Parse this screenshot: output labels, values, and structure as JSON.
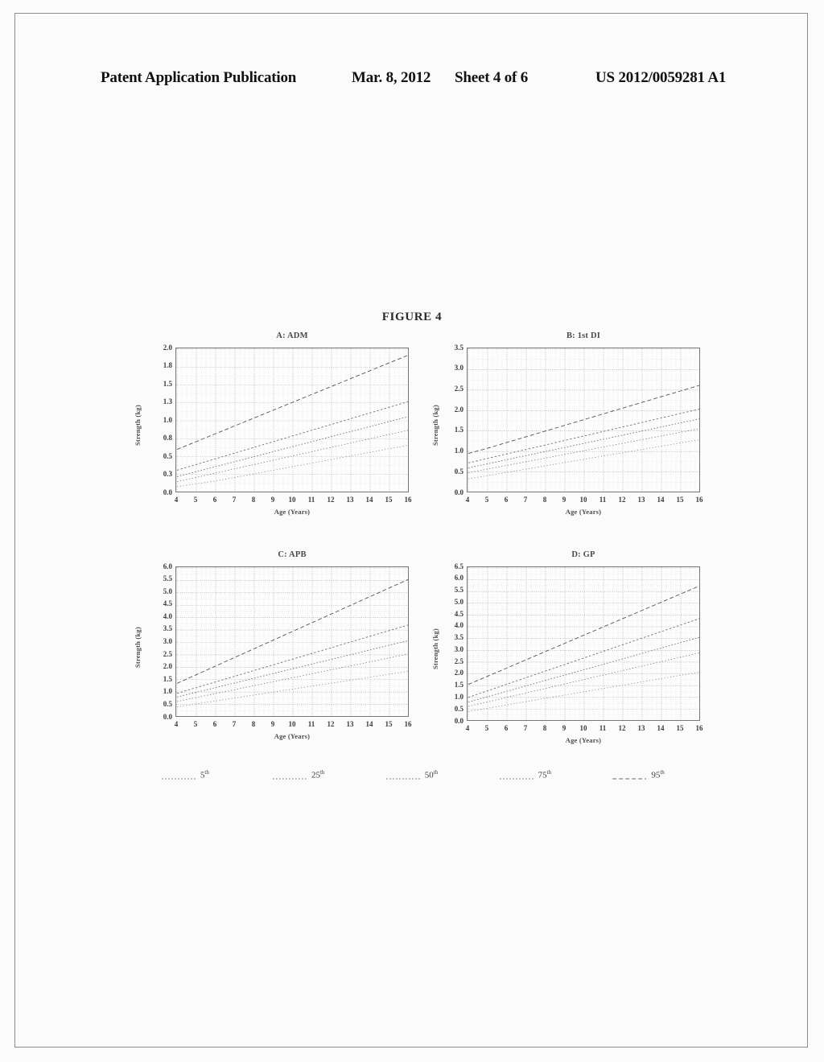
{
  "header": {
    "publication": "Patent Application Publication",
    "date": "Mar. 8, 2012",
    "sheet": "Sheet 4 of 6",
    "number": "US 2012/0059281 A1"
  },
  "figure": {
    "title": "FIGURE 4"
  },
  "legend": {
    "items": [
      {
        "label": "5",
        "suffix": "th",
        "style": "dotted"
      },
      {
        "label": "25",
        "suffix": "th",
        "style": "dotted"
      },
      {
        "label": "50",
        "suffix": "th",
        "style": "dotted"
      },
      {
        "label": "75",
        "suffix": "th",
        "style": "dotted"
      },
      {
        "label": "95",
        "suffix": "th",
        "style": "dashed"
      }
    ]
  },
  "chart_data": [
    {
      "id": "panel-a",
      "type": "line",
      "title": "A: ADM",
      "xlabel": "Age (Years)",
      "ylabel": "Strength (kg)",
      "x": [
        4,
        5,
        6,
        7,
        8,
        9,
        10,
        11,
        12,
        13,
        14,
        15,
        16
      ],
      "xticklabels": [
        "4",
        "5",
        "6",
        "7",
        "8",
        "9",
        "10",
        "11",
        "12",
        "13",
        "14",
        "15",
        "16"
      ],
      "xlim": [
        4,
        16
      ],
      "ylim": [
        0.0,
        2.0
      ],
      "yticks": [
        2.0,
        1.75,
        1.5,
        1.25,
        1.0,
        0.75,
        0.5,
        0.25,
        0.0
      ],
      "yticklabels": [
        "2.0",
        "1.8",
        "1.5",
        "1.3",
        "1.0",
        "0.8",
        "0.5",
        "0.3",
        "0.0"
      ],
      "grid": true,
      "legend_position": "below-figure",
      "series": [
        {
          "name": "95th",
          "values": [
            0.6,
            0.71,
            0.82,
            0.93,
            1.04,
            1.15,
            1.26,
            1.37,
            1.48,
            1.59,
            1.7,
            1.81,
            1.92
          ]
        },
        {
          "name": "75th",
          "values": [
            0.31,
            0.39,
            0.47,
            0.55,
            0.63,
            0.71,
            0.79,
            0.87,
            0.95,
            1.03,
            1.11,
            1.19,
            1.27
          ]
        },
        {
          "name": "50th",
          "values": [
            0.22,
            0.29,
            0.36,
            0.43,
            0.5,
            0.57,
            0.64,
            0.71,
            0.78,
            0.85,
            0.92,
            0.99,
            1.06
          ]
        },
        {
          "name": "25th",
          "values": [
            0.15,
            0.21,
            0.27,
            0.33,
            0.39,
            0.45,
            0.51,
            0.57,
            0.63,
            0.69,
            0.75,
            0.81,
            0.87
          ]
        },
        {
          "name": "5th",
          "values": [
            0.08,
            0.12,
            0.16,
            0.21,
            0.26,
            0.31,
            0.36,
            0.41,
            0.46,
            0.51,
            0.56,
            0.61,
            0.66
          ]
        }
      ]
    },
    {
      "id": "panel-b",
      "type": "line",
      "title": "B: 1st DI",
      "xlabel": "Age (Years)",
      "ylabel": "Strength (kg)",
      "x": [
        4,
        5,
        6,
        7,
        8,
        9,
        10,
        11,
        12,
        13,
        14,
        15,
        16
      ],
      "xticklabels": [
        "4",
        "5",
        "6",
        "7",
        "8",
        "9",
        "10",
        "11",
        "12",
        "13",
        "14",
        "15",
        "16"
      ],
      "xlim": [
        4,
        16
      ],
      "ylim": [
        0.0,
        3.5
      ],
      "yticks": [
        3.5,
        3.0,
        2.5,
        2.0,
        1.5,
        1.0,
        0.5,
        0.0
      ],
      "yticklabels": [
        "3.5",
        "3.0",
        "2.5",
        "2.0",
        "1.5",
        "1.0",
        "0.5",
        "0.0"
      ],
      "grid": true,
      "legend_position": "below-figure",
      "series": [
        {
          "name": "95th",
          "values": [
            0.95,
            1.08,
            1.22,
            1.36,
            1.5,
            1.64,
            1.78,
            1.92,
            2.06,
            2.2,
            2.34,
            2.48,
            2.62
          ]
        },
        {
          "name": "75th",
          "values": [
            0.72,
            0.83,
            0.94,
            1.05,
            1.16,
            1.27,
            1.38,
            1.49,
            1.6,
            1.71,
            1.82,
            1.93,
            2.04
          ]
        },
        {
          "name": "50th",
          "values": [
            0.6,
            0.7,
            0.8,
            0.9,
            1.0,
            1.1,
            1.2,
            1.3,
            1.4,
            1.5,
            1.6,
            1.7,
            1.8
          ]
        },
        {
          "name": "25th",
          "values": [
            0.48,
            0.57,
            0.66,
            0.75,
            0.84,
            0.93,
            1.02,
            1.11,
            1.2,
            1.29,
            1.38,
            1.47,
            1.56
          ]
        },
        {
          "name": "5th",
          "values": [
            0.33,
            0.41,
            0.49,
            0.57,
            0.65,
            0.73,
            0.81,
            0.89,
            0.97,
            1.05,
            1.13,
            1.21,
            1.29
          ]
        }
      ]
    },
    {
      "id": "panel-c",
      "type": "line",
      "title": "C: APB",
      "xlabel": "Age (Years)",
      "ylabel": "Strength (kg)",
      "x": [
        4,
        5,
        6,
        7,
        8,
        9,
        10,
        11,
        12,
        13,
        14,
        15,
        16
      ],
      "xticklabels": [
        "4",
        "5",
        "6",
        "7",
        "8",
        "9",
        "10",
        "11",
        "12",
        "13",
        "14",
        "15",
        "16"
      ],
      "xlim": [
        4,
        16
      ],
      "ylim": [
        0.0,
        6.0
      ],
      "yticks": [
        6.0,
        5.5,
        5.0,
        4.5,
        4.0,
        3.5,
        3.0,
        2.5,
        2.0,
        1.5,
        1.0,
        0.5,
        0.0
      ],
      "yticklabels": [
        "6.0",
        "5.5",
        "5.0",
        "4.5",
        "4.0",
        "3.5",
        "3.0",
        "2.5",
        "2.0",
        "1.5",
        "1.0",
        "0.5",
        "0.0"
      ],
      "grid": true,
      "legend_position": "below-figure",
      "series": [
        {
          "name": "95th",
          "values": [
            1.35,
            1.7,
            2.05,
            2.4,
            2.75,
            3.1,
            3.45,
            3.8,
            4.15,
            4.5,
            4.85,
            5.2,
            5.55
          ]
        },
        {
          "name": "75th",
          "values": [
            0.95,
            1.18,
            1.41,
            1.64,
            1.87,
            2.1,
            2.33,
            2.56,
            2.79,
            3.02,
            3.25,
            3.48,
            3.71
          ]
        },
        {
          "name": "50th",
          "values": [
            0.8,
            0.99,
            1.18,
            1.37,
            1.56,
            1.75,
            1.94,
            2.13,
            2.32,
            2.51,
            2.7,
            2.89,
            3.08
          ]
        },
        {
          "name": "25th",
          "values": [
            0.62,
            0.78,
            0.94,
            1.1,
            1.26,
            1.42,
            1.58,
            1.74,
            1.9,
            2.06,
            2.22,
            2.38,
            2.54
          ]
        },
        {
          "name": "5th",
          "values": [
            0.4,
            0.52,
            0.64,
            0.76,
            0.88,
            1.0,
            1.12,
            1.24,
            1.36,
            1.48,
            1.6,
            1.72,
            1.84
          ]
        }
      ]
    },
    {
      "id": "panel-d",
      "type": "line",
      "title": "D: GP",
      "xlabel": "Age (Years)",
      "ylabel": "Strength (kg)",
      "x": [
        4,
        5,
        6,
        7,
        8,
        9,
        10,
        11,
        12,
        13,
        14,
        15,
        16
      ],
      "xticklabels": [
        "4",
        "5",
        "6",
        "7",
        "8",
        "9",
        "10",
        "11",
        "12",
        "13",
        "14",
        "15",
        "16"
      ],
      "xlim": [
        0.0,
        6.5
      ],
      "ylim": [
        0.0,
        6.5
      ],
      "yticks": [
        6.5,
        6.0,
        5.5,
        5.0,
        4.5,
        4.0,
        3.5,
        3.0,
        2.5,
        2.0,
        1.5,
        1.0,
        0.5,
        0.0
      ],
      "yticklabels": [
        "6.5",
        "6.0",
        "5.5",
        "5.0",
        "4.5",
        "4.0",
        "3.5",
        "3.0",
        "2.5",
        "2.0",
        "1.5",
        "1.0",
        "0.5",
        "0.0"
      ],
      "grid": true,
      "legend_position": "below-figure",
      "series": [
        {
          "name": "95th",
          "values": [
            1.55,
            1.9,
            2.25,
            2.6,
            2.95,
            3.3,
            3.65,
            4.0,
            4.35,
            4.7,
            5.05,
            5.4,
            5.75
          ]
        },
        {
          "name": "75th",
          "values": [
            1.0,
            1.28,
            1.56,
            1.84,
            2.12,
            2.4,
            2.68,
            2.96,
            3.24,
            3.52,
            3.8,
            4.08,
            4.36
          ]
        },
        {
          "name": "50th",
          "values": [
            0.8,
            1.03,
            1.26,
            1.49,
            1.72,
            1.95,
            2.18,
            2.41,
            2.64,
            2.87,
            3.1,
            3.33,
            3.56
          ]
        },
        {
          "name": "25th",
          "values": [
            0.62,
            0.81,
            1.0,
            1.19,
            1.38,
            1.57,
            1.76,
            1.95,
            2.14,
            2.33,
            2.52,
            2.71,
            2.9
          ]
        },
        {
          "name": "5th",
          "values": [
            0.4,
            0.54,
            0.68,
            0.82,
            0.96,
            1.1,
            1.24,
            1.38,
            1.52,
            1.66,
            1.8,
            1.94,
            2.08
          ]
        }
      ]
    }
  ]
}
